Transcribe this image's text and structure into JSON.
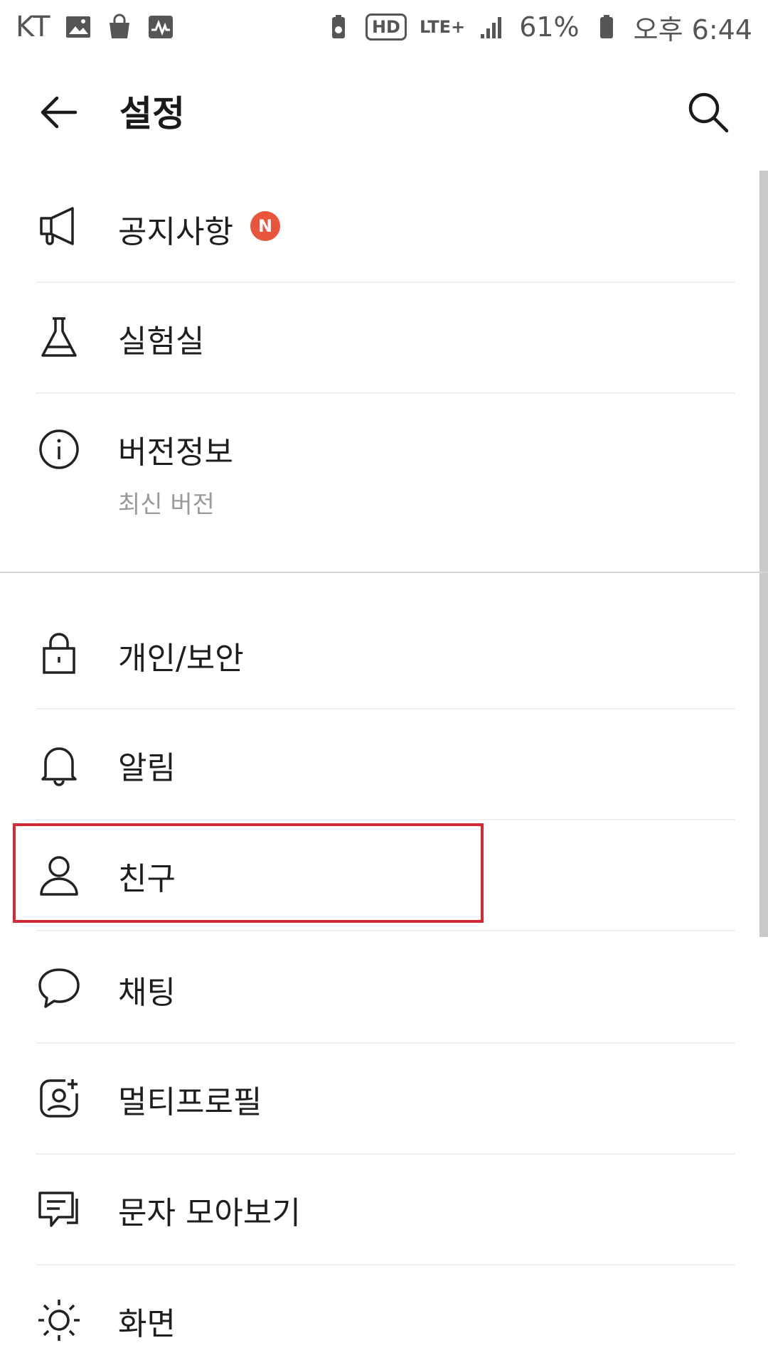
{
  "status_bar": {
    "carrier": "KT",
    "network": "LTE+",
    "hd": "HD",
    "battery_percent": "61%",
    "time": "오후 6:44"
  },
  "header": {
    "title": "설정"
  },
  "menu": {
    "notice": {
      "label": "공지사항",
      "badge": "N",
      "icon": "megaphone-icon"
    },
    "lab": {
      "label": "실험실",
      "icon": "flask-icon"
    },
    "version": {
      "label": "버전정보",
      "sub": "최신 버전",
      "icon": "info-icon"
    },
    "privacy": {
      "label": "개인/보안",
      "icon": "lock-icon"
    },
    "alarm": {
      "label": "알림",
      "icon": "bell-icon"
    },
    "friends": {
      "label": "친구",
      "icon": "person-icon"
    },
    "chat": {
      "label": "채팅",
      "icon": "chat-bubble-icon"
    },
    "multiprofile": {
      "label": "멀티프로필",
      "icon": "profile-add-icon"
    },
    "sms": {
      "label": "문자 모아보기",
      "icon": "message-icon"
    },
    "display": {
      "label": "화면",
      "icon": "sun-icon"
    }
  },
  "colors": {
    "badge": "#e8553a",
    "highlight": "#d42a35",
    "text": "#1e1e1e",
    "subtext": "#9a9a9a"
  }
}
